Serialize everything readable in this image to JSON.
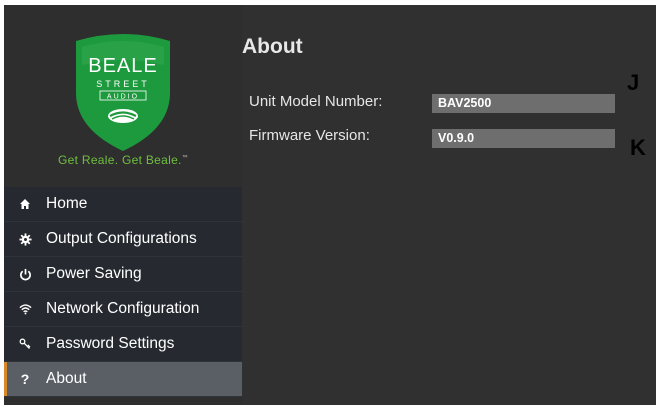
{
  "brand": {
    "name_line1": "BEALE",
    "name_line2": "STREET",
    "name_line3": "AUDIO",
    "tagline": "Get Reale. Get Beale.",
    "trademark": "™",
    "colors": {
      "shield": "#1e9a3e",
      "tagline": "#6fbf3f"
    }
  },
  "sidebar": {
    "items": [
      {
        "label": "Home",
        "icon": "home-icon"
      },
      {
        "label": "Output Configurations",
        "icon": "gear-icon"
      },
      {
        "label": "Power Saving",
        "icon": "power-icon"
      },
      {
        "label": "Network Configuration",
        "icon": "wifi-icon"
      },
      {
        "label": "Password Settings",
        "icon": "key-icon"
      },
      {
        "label": "About",
        "icon": "question-icon",
        "active": true
      }
    ],
    "active_accent": "#d88a2a"
  },
  "main": {
    "title": "About",
    "fields": [
      {
        "label": "Unit Model Number:",
        "value": "BAV2500"
      },
      {
        "label": "Firmware Version:",
        "value": "V0.9.0"
      }
    ]
  },
  "callouts": {
    "j": "J",
    "k": "K"
  }
}
